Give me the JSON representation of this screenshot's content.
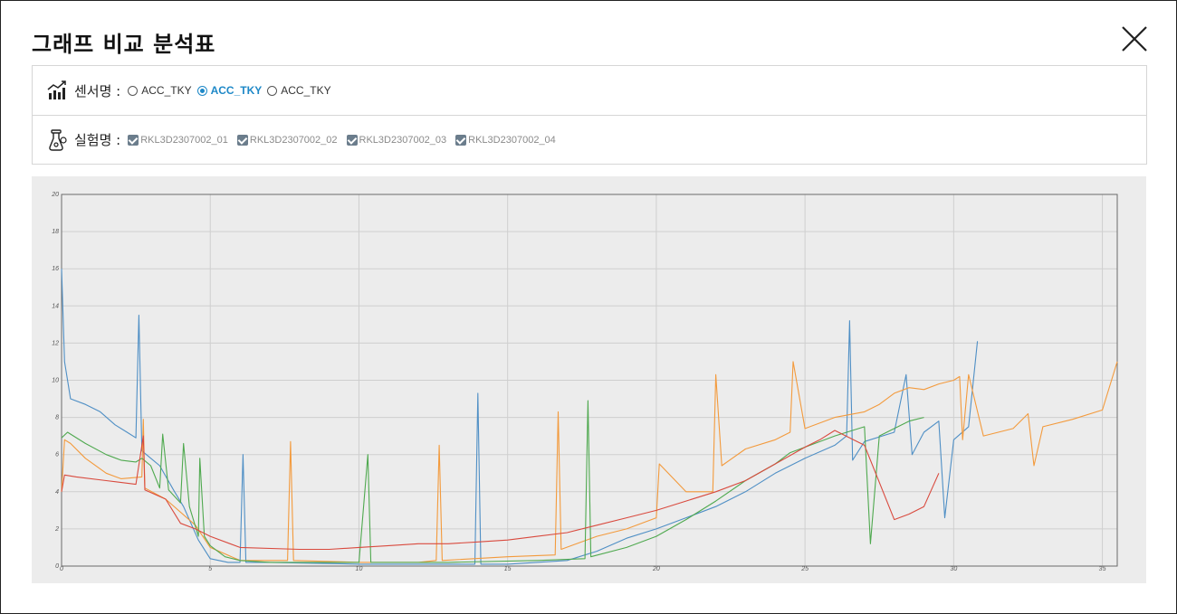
{
  "header": {
    "title": "그래프 비교 분석표"
  },
  "sensor": {
    "label": "센서명 :",
    "options": [
      {
        "label": "ACC_TKY",
        "selected": false
      },
      {
        "label": "ACC_TKY",
        "selected": true
      },
      {
        "label": "ACC_TKY",
        "selected": false
      }
    ]
  },
  "experiment": {
    "label": "실험명 :",
    "items": [
      {
        "label": "RKL3D2307002_01",
        "checked": true
      },
      {
        "label": "RKL3D2307002_02",
        "checked": true
      },
      {
        "label": "RKL3D2307002_03",
        "checked": true
      },
      {
        "label": "RKL3D2307002_04",
        "checked": true
      }
    ]
  },
  "colors": {
    "accent": "#1e88c7",
    "plot_bg": "#ececec",
    "grid": "#cfcfcf"
  },
  "chart_data": {
    "type": "line",
    "title": "",
    "xlabel": "",
    "ylabel": "",
    "xlim": [
      0,
      35.5
    ],
    "ylim": [
      0,
      20
    ],
    "x_ticks": [
      0,
      5,
      10,
      15,
      20,
      25,
      30,
      35
    ],
    "y_ticks": [
      0,
      2,
      4,
      6,
      8,
      10,
      12,
      14,
      16,
      18,
      20
    ],
    "grid": true,
    "series": [
      {
        "color": "#4f8fc5",
        "points": [
          [
            0,
            16
          ],
          [
            0.1,
            11
          ],
          [
            0.3,
            9
          ],
          [
            0.8,
            8.7
          ],
          [
            1.3,
            8.3
          ],
          [
            1.8,
            7.6
          ],
          [
            2.2,
            7.2
          ],
          [
            2.5,
            6.9
          ],
          [
            2.6,
            13.5
          ],
          [
            2.7,
            6.2
          ],
          [
            3.3,
            5.4
          ],
          [
            3.8,
            4
          ],
          [
            4.1,
            3.2
          ],
          [
            4.6,
            1.4
          ],
          [
            5,
            0.4
          ],
          [
            5.6,
            0.2
          ],
          [
            6,
            0.2
          ],
          [
            6.1,
            6
          ],
          [
            6.2,
            0.2
          ],
          [
            7,
            0.2
          ],
          [
            10,
            0.1
          ],
          [
            13,
            0.1
          ],
          [
            13.9,
            0.1
          ],
          [
            14,
            9.3
          ],
          [
            14.1,
            0.1
          ],
          [
            15,
            0.1
          ],
          [
            17,
            0.3
          ],
          [
            18,
            0.8
          ],
          [
            19,
            1.5
          ],
          [
            20,
            2
          ],
          [
            21,
            2.6
          ],
          [
            22,
            3.2
          ],
          [
            23,
            4
          ],
          [
            24,
            5
          ],
          [
            25,
            5.8
          ],
          [
            26,
            6.5
          ],
          [
            26.4,
            7
          ],
          [
            26.5,
            13.2
          ],
          [
            26.6,
            5.7
          ],
          [
            27,
            6.7
          ],
          [
            28,
            7.2
          ],
          [
            28.4,
            10.3
          ],
          [
            28.6,
            6
          ],
          [
            29,
            7.2
          ],
          [
            29.5,
            7.8
          ],
          [
            29.7,
            2.6
          ],
          [
            30,
            6.8
          ],
          [
            30.5,
            7.5
          ],
          [
            30.8,
            12.1
          ]
        ]
      },
      {
        "color": "#f39a3c",
        "points": [
          [
            0,
            4
          ],
          [
            0.1,
            6.8
          ],
          [
            0.3,
            6.6
          ],
          [
            0.8,
            5.8
          ],
          [
            1.5,
            5
          ],
          [
            2,
            4.7
          ],
          [
            2.7,
            4.8
          ],
          [
            2.75,
            7.9
          ],
          [
            2.8,
            4.2
          ],
          [
            3.5,
            3.6
          ],
          [
            4.5,
            2.2
          ],
          [
            5,
            1
          ],
          [
            6,
            0.3
          ],
          [
            7.6,
            0.3
          ],
          [
            7.7,
            6.7
          ],
          [
            7.8,
            0.3
          ],
          [
            10,
            0.2
          ],
          [
            11,
            0.2
          ],
          [
            12,
            0.2
          ],
          [
            12.6,
            0.3
          ],
          [
            12.7,
            6.5
          ],
          [
            12.8,
            0.3
          ],
          [
            15,
            0.5
          ],
          [
            16.6,
            0.6
          ],
          [
            16.7,
            8.3
          ],
          [
            16.8,
            0.9
          ],
          [
            18,
            1.6
          ],
          [
            19,
            2
          ],
          [
            20,
            2.6
          ],
          [
            20.1,
            5.5
          ],
          [
            21,
            4
          ],
          [
            21.9,
            4
          ],
          [
            22,
            10.3
          ],
          [
            22.2,
            5.4
          ],
          [
            23,
            6.3
          ],
          [
            24,
            6.8
          ],
          [
            24.5,
            7.2
          ],
          [
            24.6,
            11
          ],
          [
            25,
            7.4
          ],
          [
            26,
            8
          ],
          [
            27,
            8.3
          ],
          [
            27.5,
            8.7
          ],
          [
            28,
            9.3
          ],
          [
            28.5,
            9.6
          ],
          [
            29,
            9.5
          ],
          [
            29.5,
            9.8
          ],
          [
            30,
            10
          ],
          [
            30.2,
            10.2
          ],
          [
            30.3,
            6.8
          ],
          [
            30.5,
            10.3
          ],
          [
            31,
            7
          ],
          [
            32,
            7.4
          ],
          [
            32.5,
            8.2
          ],
          [
            32.7,
            5.4
          ],
          [
            33,
            7.5
          ],
          [
            34,
            7.9
          ],
          [
            35,
            8.4
          ],
          [
            35.5,
            11
          ]
        ]
      },
      {
        "color": "#4fa94f",
        "points": [
          [
            0,
            6.9
          ],
          [
            0.2,
            7.2
          ],
          [
            0.8,
            6.6
          ],
          [
            1.5,
            6
          ],
          [
            2,
            5.7
          ],
          [
            2.5,
            5.6
          ],
          [
            2.7,
            5.8
          ],
          [
            3,
            5.4
          ],
          [
            3.3,
            4.2
          ],
          [
            3.4,
            7.1
          ],
          [
            3.6,
            4.1
          ],
          [
            4,
            3.4
          ],
          [
            4.1,
            6.6
          ],
          [
            4.3,
            3.2
          ],
          [
            4.6,
            1.6
          ],
          [
            4.65,
            5.8
          ],
          [
            4.8,
            1.6
          ],
          [
            5,
            1.1
          ],
          [
            5.5,
            0.5
          ],
          [
            6,
            0.3
          ],
          [
            7,
            0.2
          ],
          [
            10,
            0.2
          ],
          [
            10.3,
            6
          ],
          [
            10.4,
            0.2
          ],
          [
            13,
            0.2
          ],
          [
            16,
            0.3
          ],
          [
            17.6,
            0.4
          ],
          [
            17.7,
            8.9
          ],
          [
            17.8,
            0.5
          ],
          [
            19,
            1
          ],
          [
            20,
            1.6
          ],
          [
            21,
            2.5
          ],
          [
            22,
            3.5
          ],
          [
            23,
            4.6
          ],
          [
            24,
            5.5
          ],
          [
            24.5,
            6.1
          ],
          [
            25,
            6.4
          ],
          [
            26,
            7
          ],
          [
            27,
            7.5
          ],
          [
            27.2,
            1.2
          ],
          [
            27.5,
            7
          ],
          [
            28,
            7.4
          ],
          [
            28.5,
            7.8
          ],
          [
            29,
            8
          ]
        ]
      },
      {
        "color": "#d94a3e",
        "points": [
          [
            0,
            4
          ],
          [
            0.1,
            4.9
          ],
          [
            0.5,
            4.8
          ],
          [
            1.5,
            4.6
          ],
          [
            2.5,
            4.4
          ],
          [
            2.75,
            7
          ],
          [
            2.8,
            4.1
          ],
          [
            3.5,
            3.6
          ],
          [
            4,
            2.3
          ],
          [
            4.5,
            2
          ],
          [
            5,
            1.6
          ],
          [
            6,
            1
          ],
          [
            8,
            0.9
          ],
          [
            9,
            0.9
          ],
          [
            10,
            1
          ],
          [
            11,
            1.1
          ],
          [
            12,
            1.2
          ],
          [
            13,
            1.2
          ],
          [
            14,
            1.3
          ],
          [
            15,
            1.4
          ],
          [
            16,
            1.6
          ],
          [
            17,
            1.8
          ],
          [
            18,
            2.2
          ],
          [
            19,
            2.6
          ],
          [
            20,
            3
          ],
          [
            21,
            3.5
          ],
          [
            22,
            4
          ],
          [
            23,
            4.6
          ],
          [
            24,
            5.5
          ],
          [
            25,
            6.4
          ],
          [
            25.5,
            6.8
          ],
          [
            26,
            7.3
          ],
          [
            27,
            6.5
          ],
          [
            28,
            2.5
          ],
          [
            28.5,
            2.8
          ],
          [
            29,
            3.2
          ],
          [
            29.5,
            5
          ]
        ]
      }
    ]
  }
}
